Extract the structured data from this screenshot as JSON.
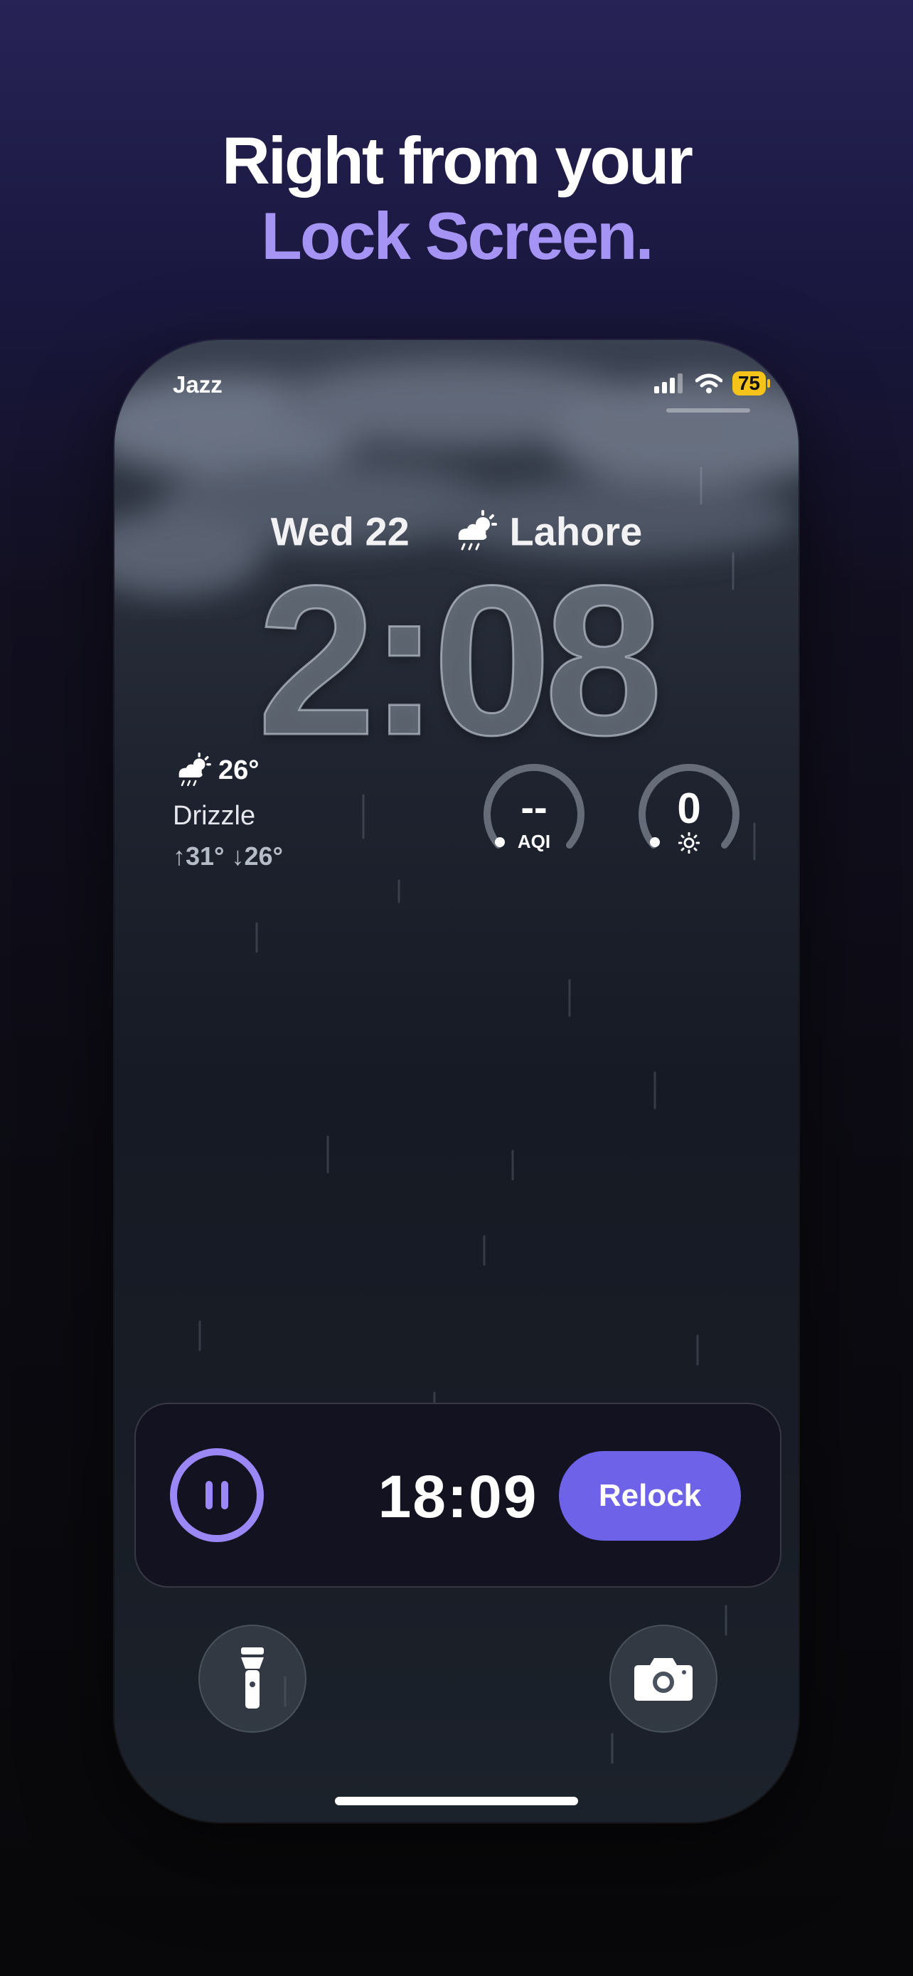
{
  "promo": {
    "headline_line1": "Right from your",
    "headline_line2": "Lock Screen.",
    "accent_color": "#a594f3"
  },
  "lock_screen": {
    "status_bar": {
      "carrier": "Jazz",
      "battery_percent": "75",
      "icons": [
        "signal-icon",
        "wifi-icon",
        "battery-icon"
      ]
    },
    "date": "Wed 22",
    "location": "Lahore",
    "location_icon": "cloud-sun-rain-icon",
    "time": "2:08",
    "weather_widget": {
      "icon": "cloud-sun-rain-icon",
      "temperature": "26°",
      "condition": "Drizzle",
      "range": "↑31° ↓26°"
    },
    "aqi_gauge": {
      "value": "--",
      "label": "AQI"
    },
    "uv_gauge": {
      "value": "0",
      "icon": "sun-icon"
    },
    "live_activity": {
      "timer": "18:09",
      "pause_icon": "pause-icon",
      "relock_label": "Relock",
      "accent_color": "#6d62e8"
    },
    "quick_actions": [
      "flashlight-icon",
      "camera-icon"
    ]
  }
}
